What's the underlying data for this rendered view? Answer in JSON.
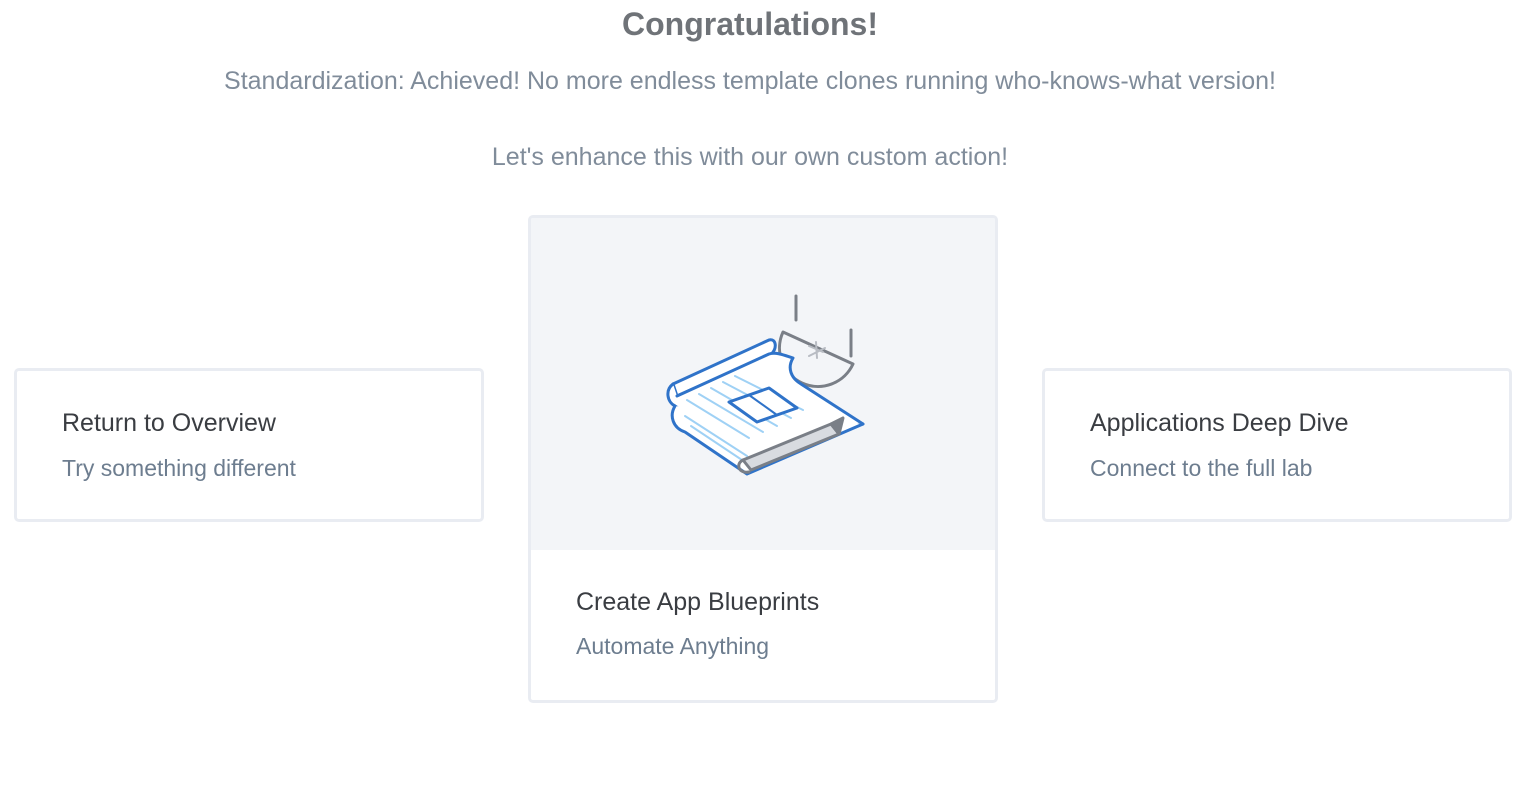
{
  "header": {
    "title": "Congratulations!",
    "line1": "Standardization: Achieved! No more endless template clones running who-knows-what version!",
    "line2": "Let's enhance this with our own custom action!"
  },
  "cards": {
    "left": {
      "title": "Return to Overview",
      "subtitle": "Try something different"
    },
    "center": {
      "title": "Create App Blueprints",
      "subtitle": "Automate Anything",
      "illustration": "blueprint-icon"
    },
    "right": {
      "title": "Applications Deep Dive",
      "subtitle": "Connect to the full lab"
    }
  },
  "colors": {
    "title": "#6f7378",
    "subtitle": "#808c9a",
    "card_border": "#e9ecf2",
    "hero_bg": "#f3f5f8",
    "blueprint_blue": "#2f73c9",
    "blueprint_light": "#9fd1f5"
  }
}
